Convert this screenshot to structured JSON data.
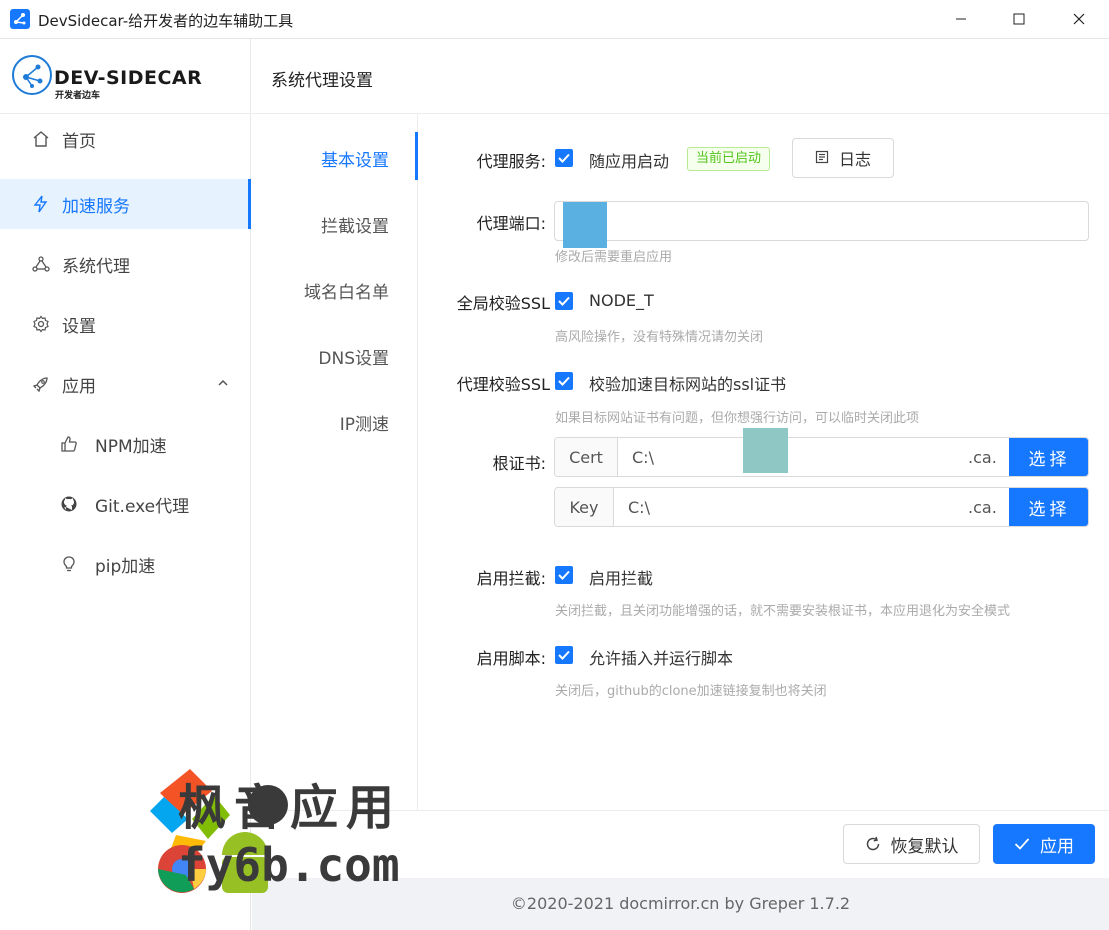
{
  "window": {
    "title": "DevSidecar-给开发者的边车辅助工具",
    "minimize": "—",
    "maximize": "☐",
    "close": "✕"
  },
  "logo": {
    "name": "DEV-SIDECAR",
    "subtitle": "开发者边车"
  },
  "sidebar": {
    "items": [
      {
        "label": "首页",
        "icon": "home-icon"
      },
      {
        "label": "加速服务",
        "icon": "lightning-icon",
        "active": true
      },
      {
        "label": "系统代理",
        "icon": "network-icon"
      },
      {
        "label": "设置",
        "icon": "gear-icon"
      },
      {
        "label": "应用",
        "icon": "rocket-icon",
        "expanded": true
      }
    ],
    "subitems": [
      {
        "label": "NPM加速",
        "icon": "thumbs-up-icon"
      },
      {
        "label": "Git.exe代理",
        "icon": "github-icon"
      },
      {
        "label": "pip加速",
        "icon": "bulb-icon"
      }
    ]
  },
  "header": {
    "title": "系统代理设置"
  },
  "tabs": [
    {
      "label": "基本设置",
      "active": true
    },
    {
      "label": "拦截设置"
    },
    {
      "label": "域名白名单"
    },
    {
      "label": "DNS设置"
    },
    {
      "label": "IP测速"
    }
  ],
  "form": {
    "proxy_service": {
      "label": "代理服务:",
      "checkbox_text": "随应用启动",
      "status_badge": "当前已启动",
      "log_button": "日志"
    },
    "proxy_port": {
      "label": "代理端口:",
      "value": "",
      "hint": "修改后需要重启应用"
    },
    "global_ssl": {
      "label": "全局校验SSL",
      "checkbox_text": "NODE_T",
      "hint": "高风险操作，没有特殊情况请勿关闭"
    },
    "proxy_ssl": {
      "label": "代理校验SSL",
      "checkbox_text": "校验加速目标网站的ssl证书",
      "hint": "如果目标网站证书有问题，但你想强行访问，可以临时关闭此项"
    },
    "root_cert": {
      "label": "根证书:",
      "cert_addon": "Cert",
      "cert_value": "C:\\",
      "cert_tail": ".ca.",
      "key_addon": "Key",
      "key_value": "C:\\",
      "key_tail": ".ca.",
      "select_label": "选择"
    },
    "enable_intercept": {
      "label": "启用拦截:",
      "checkbox_text": "启用拦截",
      "hint": "关闭拦截，且关闭功能增强的话，就不需要安装根证书，本应用退化为安全模式"
    },
    "enable_script": {
      "label": "启用脚本:",
      "checkbox_text": "允许插入并运行脚本",
      "hint": "关闭后，github的clone加速链接复制也将关闭"
    }
  },
  "buttons": {
    "reset": "恢复默认",
    "apply": "应用"
  },
  "footer": {
    "text": "©2020-2021 docmirror.cn by Greper 1.7.2"
  },
  "watermark": {
    "line1": "枫音应用",
    "line2": "fy6b.com"
  },
  "colors": {
    "primary": "#1677ff",
    "success": "#52c41a",
    "active_bg": "#e6f3ff"
  }
}
